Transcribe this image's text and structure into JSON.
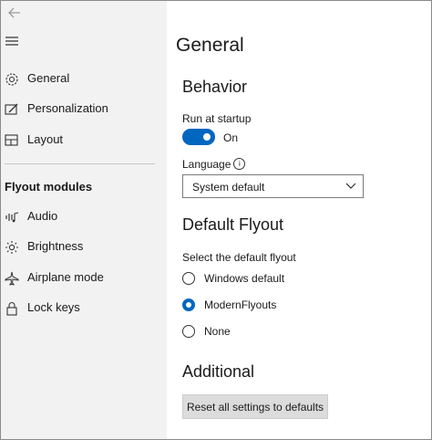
{
  "sidebar": {
    "items": [
      {
        "label": "General",
        "icon": "gear-icon"
      },
      {
        "label": "Personalization",
        "icon": "personalization-icon"
      },
      {
        "label": "Layout",
        "icon": "layout-icon"
      }
    ],
    "section_title": "Flyout modules",
    "modules": [
      {
        "label": "Audio",
        "icon": "audio-icon"
      },
      {
        "label": "Brightness",
        "icon": "brightness-icon"
      },
      {
        "label": "Airplane mode",
        "icon": "airplane-icon"
      },
      {
        "label": "Lock keys",
        "icon": "lock-icon"
      }
    ]
  },
  "main": {
    "title": "General",
    "behavior": {
      "heading": "Behavior",
      "startup_label": "Run at startup",
      "startup_state": "On",
      "language_label": "Language",
      "language_value": "System default"
    },
    "default_flyout": {
      "heading": "Default Flyout",
      "prompt": "Select the default flyout",
      "options": [
        "Windows default",
        "ModernFlyouts",
        "None"
      ],
      "selected": "ModernFlyouts"
    },
    "additional": {
      "heading": "Additional",
      "reset_label": "Reset all settings to defaults"
    }
  },
  "colors": {
    "accent": "#0067c0",
    "sidebar_bg": "#f2f2f2"
  }
}
